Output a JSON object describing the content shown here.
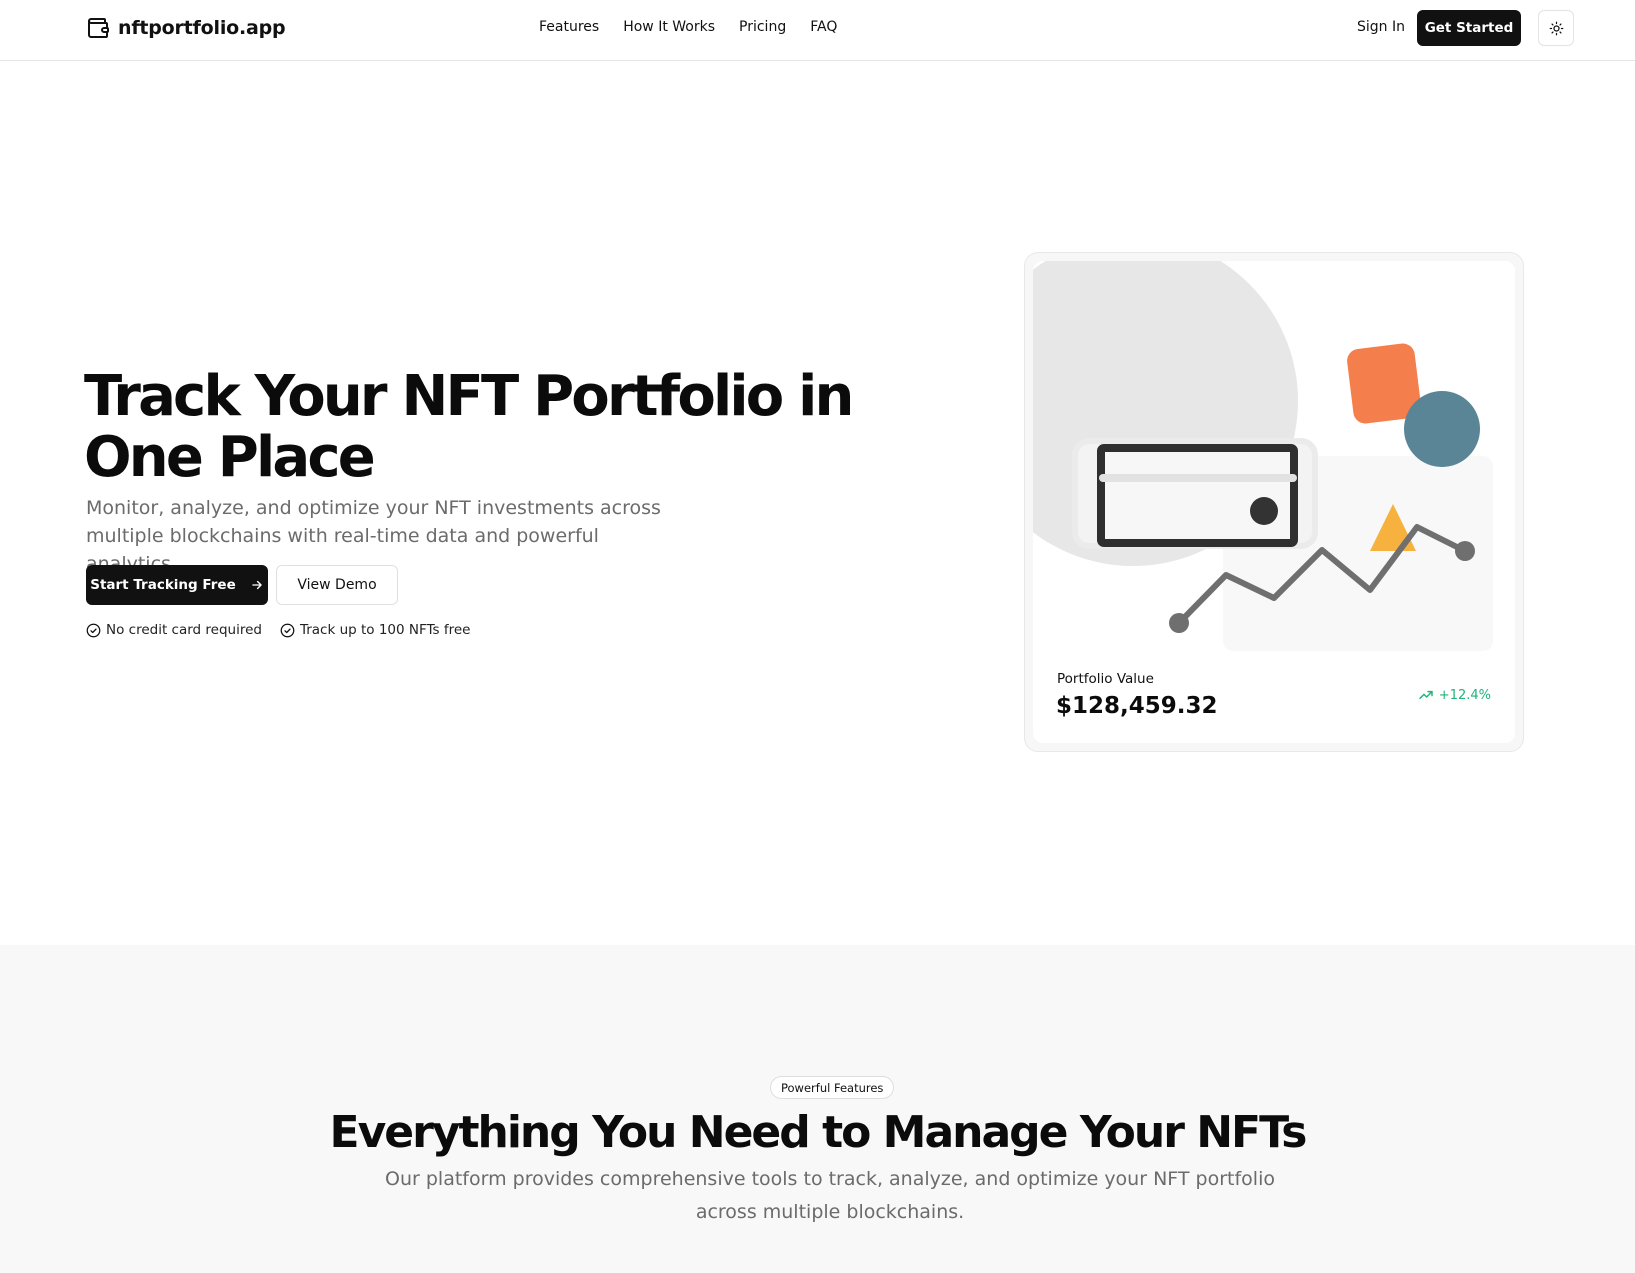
{
  "header": {
    "brand_name": "nftportfolio.app",
    "nav": [
      {
        "label": "Features"
      },
      {
        "label": "How It Works"
      },
      {
        "label": "Pricing"
      },
      {
        "label": "FAQ"
      }
    ],
    "sign_in_label": "Sign In",
    "get_started_label": "Get Started",
    "icons": {
      "brand": "wallet-icon",
      "theme_toggle": "sun-icon"
    }
  },
  "hero": {
    "title": "Track Your NFT Portfolio in One Place",
    "subtitle": "Monitor, analyze, and optimize your NFT investments across multiple blockchains with real-time data and powerful analytics.",
    "primary_cta": "Start Tracking Free",
    "secondary_cta": "View Demo",
    "perks": [
      {
        "label": "No credit card required",
        "icon": "check-circle-icon"
      },
      {
        "label": "Track up to 100 NFTs free",
        "icon": "check-circle-icon"
      }
    ],
    "card": {
      "label": "Portfolio Value",
      "value": "$128,459.32",
      "change": "+12.4%",
      "change_icon": "trending-up-icon"
    }
  },
  "features": {
    "badge": "Powerful Features",
    "title": "Everything You Need to Manage Your NFTs",
    "subtitle": "Our platform provides comprehensive tools to track, analyze, and optimize your NFT portfolio across multiple blockchains."
  },
  "colors": {
    "primary": "#111111",
    "muted_text": "#6b6b6b",
    "positive": "#1fb47a",
    "accent_orange": "#f47e4c",
    "accent_teal": "#5a8596",
    "accent_yellow": "#f6b13e",
    "section_bg": "#f8f8f8"
  }
}
